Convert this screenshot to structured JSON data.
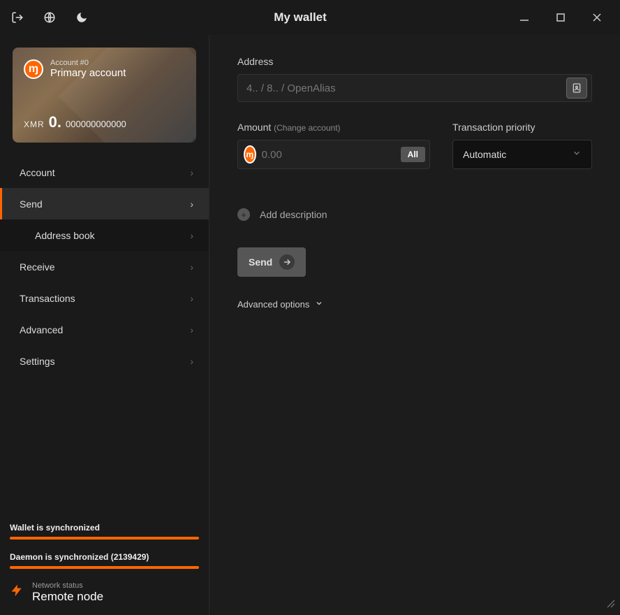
{
  "titlebar": {
    "title": "My wallet"
  },
  "account_card": {
    "sub": "Account #0",
    "name": "Primary account",
    "currency": "XMR",
    "balance_int": "0.",
    "balance_dec": "000000000000"
  },
  "nav": {
    "account": "Account",
    "send": "Send",
    "address_book": "Address book",
    "receive": "Receive",
    "transactions": "Transactions",
    "advanced": "Advanced",
    "settings": "Settings"
  },
  "status": {
    "wallet_sync": "Wallet is synchronized",
    "daemon_sync": "Daemon is synchronized (2139429)",
    "net_label": "Network status",
    "net_value": "Remote node"
  },
  "send": {
    "address_label": "Address",
    "address_placeholder": "4.. / 8.. / OpenAlias",
    "amount_label": "Amount",
    "amount_hint": "(Change account)",
    "amount_placeholder": "0.00",
    "all_btn": "All",
    "priority_label": "Transaction priority",
    "priority_value": "Automatic",
    "add_desc": "Add description",
    "send_btn": "Send",
    "adv_opt": "Advanced options"
  }
}
